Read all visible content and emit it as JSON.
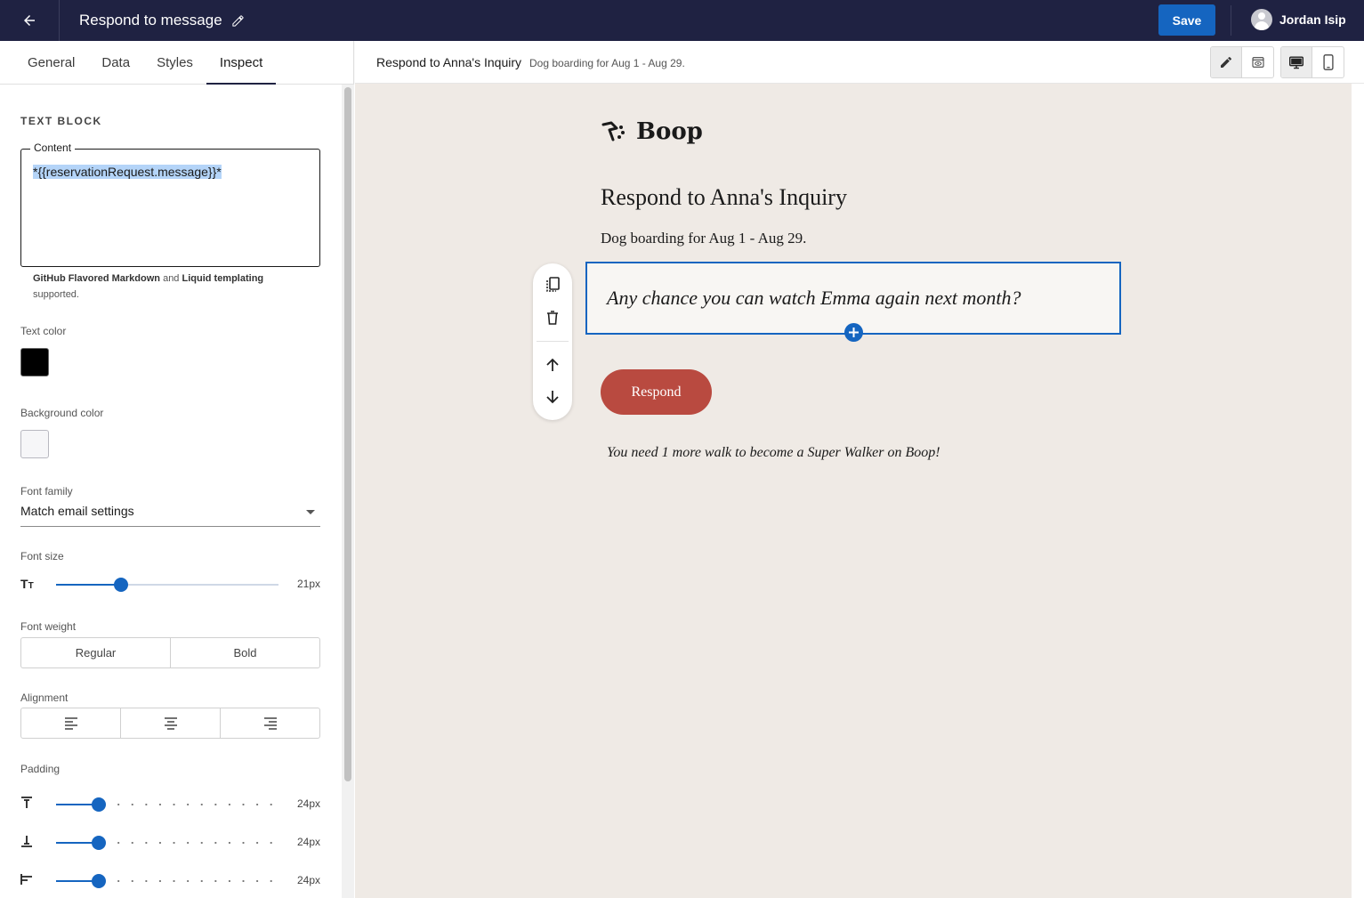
{
  "topbar": {
    "title": "Respond to message",
    "save_label": "Save",
    "user_name": "Jordan Isip"
  },
  "tabs": [
    {
      "label": "General"
    },
    {
      "label": "Data"
    },
    {
      "label": "Styles"
    },
    {
      "label": "Inspect"
    }
  ],
  "inspect": {
    "section_title": "TEXT BLOCK",
    "content_label": "Content",
    "content_value": "*{{reservationRequest.message}}*",
    "help": {
      "part1": "GitHub Flavored Markdown",
      "part2": " and ",
      "part3": "Liquid templating",
      "part4": " supported."
    },
    "text_color_label": "Text color",
    "text_color": "#000000",
    "background_color_label": "Background color",
    "background_color": "#f6f6f8",
    "font_family_label": "Font family",
    "font_family_value": "Match email settings",
    "font_size_label": "Font size",
    "font_size_value": "21px",
    "font_size_fraction": 0.29,
    "font_weight_label": "Font weight",
    "font_weight_options": [
      "Regular",
      "Bold"
    ],
    "alignment_label": "Alignment",
    "padding_label": "Padding",
    "padding_top_value": "24px",
    "padding_bottom_value": "24px",
    "padding_left_value": "24px",
    "padding_fraction": 0.19
  },
  "preview": {
    "title": "Respond to Anna's Inquiry",
    "subtitle": "Dog boarding for Aug 1 - Aug 29."
  },
  "email": {
    "brand": "Boop",
    "heading": "Respond to Anna's Inquiry",
    "subheading": "Dog boarding for Aug 1 - Aug 29.",
    "message": "Any chance you can watch Emma again next month?",
    "button_label": "Respond",
    "footer_note": "You need 1 more walk to become a Super Walker on Boop!",
    "button_color": "#b94a40",
    "canvas_color": "#efeae5"
  },
  "colors": {
    "topbar": "#1f2242",
    "accent": "#1565c0"
  }
}
